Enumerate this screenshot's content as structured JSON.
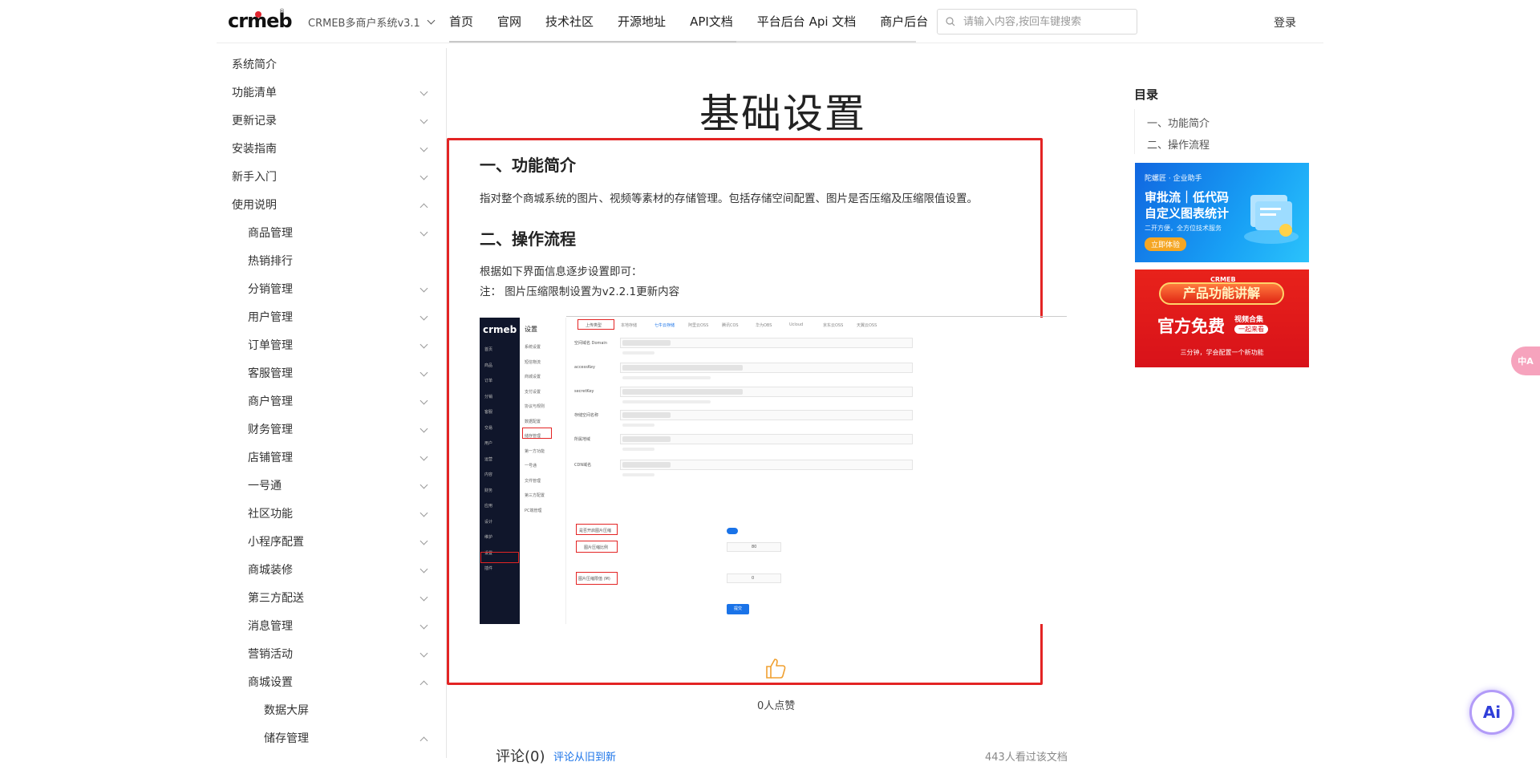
{
  "header": {
    "logo_text": "crmeb",
    "logo_reg": "®",
    "version": "CRMEB多商户系统v3.1",
    "nav": [
      "首页",
      "官网",
      "技术社区",
      "开源地址",
      "API文档",
      "平台后台 Api 文档",
      "商户后台"
    ],
    "search_placeholder": "请输入内容,按回车键搜索",
    "login": "登录"
  },
  "sidebar": {
    "items": [
      {
        "label": "系统简介",
        "level": 1,
        "chevron": "none"
      },
      {
        "label": "功能清单",
        "level": 1,
        "chevron": "down"
      },
      {
        "label": "更新记录",
        "level": 1,
        "chevron": "down"
      },
      {
        "label": "安装指南",
        "level": 1,
        "chevron": "down"
      },
      {
        "label": "新手入门",
        "level": 1,
        "chevron": "down"
      },
      {
        "label": "使用说明",
        "level": 1,
        "chevron": "up"
      },
      {
        "label": "商品管理",
        "level": 2,
        "chevron": "down"
      },
      {
        "label": "热销排行",
        "level": 2,
        "chevron": "none"
      },
      {
        "label": "分销管理",
        "level": 2,
        "chevron": "down"
      },
      {
        "label": "用户管理",
        "level": 2,
        "chevron": "down"
      },
      {
        "label": "订单管理",
        "level": 2,
        "chevron": "down"
      },
      {
        "label": "客服管理",
        "level": 2,
        "chevron": "down"
      },
      {
        "label": "商户管理",
        "level": 2,
        "chevron": "down"
      },
      {
        "label": "财务管理",
        "level": 2,
        "chevron": "down"
      },
      {
        "label": "店铺管理",
        "level": 2,
        "chevron": "down"
      },
      {
        "label": "一号通",
        "level": 2,
        "chevron": "down"
      },
      {
        "label": "社区功能",
        "level": 2,
        "chevron": "down"
      },
      {
        "label": "小程序配置",
        "level": 2,
        "chevron": "down"
      },
      {
        "label": "商城装修",
        "level": 2,
        "chevron": "down"
      },
      {
        "label": "第三方配送",
        "level": 2,
        "chevron": "down"
      },
      {
        "label": "消息管理",
        "level": 2,
        "chevron": "down"
      },
      {
        "label": "营销活动",
        "level": 2,
        "chevron": "down"
      },
      {
        "label": "商城设置",
        "level": 2,
        "chevron": "up"
      },
      {
        "label": "数据大屏",
        "level": 3,
        "chevron": "none"
      },
      {
        "label": "储存管理",
        "level": 3,
        "chevron": "up"
      }
    ]
  },
  "main": {
    "title": "基础设置",
    "section1_heading": "一、功能简介",
    "section1_text": "指对整个商城系统的图片、视频等素材的存储管理。包括存储空间配置、图片是否压缩及压缩限值设置。",
    "section2_heading": "二、操作流程",
    "section2_text1": "根据如下界面信息逐步设置即可：",
    "section2_text2": "注：   图片压缩限制设置为v2.2.1更新内容",
    "like_count": "0人点赞",
    "comments_title": "评论(0)",
    "comments_sort": "评论从旧到新",
    "views": "443人看过该文档"
  },
  "embedded_screenshot": {
    "logo": "crmeb",
    "sub_title": "设置",
    "side_items": [
      "首页",
      "商品",
      "订单",
      "分销",
      "客服",
      "交易",
      "用户",
      "运营",
      "内容",
      "财务",
      "应用",
      "设计",
      "维护",
      "设置",
      "插件"
    ],
    "sub_items": [
      "系统设置",
      "短信物流",
      "商城设置",
      "支付设置",
      "协议与规则",
      "数据配置",
      "储存管理",
      "第一方功能",
      "一号通",
      "文件管理",
      "第三方配置",
      "PC端管理"
    ],
    "upload_label": "上传类型",
    "upload_options": [
      "本地存储",
      "七牛云存储",
      "阿里云OSS",
      "腾讯COS",
      "华为OBS",
      "Ucloud",
      "京东云OSS",
      "天翼云OSS"
    ],
    "fields": [
      "空间域名 Domain",
      "accessKey",
      "secretKey",
      "存储空间名称",
      "所属地域",
      "CDN域名"
    ],
    "compress_label": "是否开启图片压缩",
    "ratio_label": "图片压缩比例",
    "ratio_value": "80",
    "limit_label": "图片压缩限值 (M)",
    "limit_value": "0",
    "submit": "提交"
  },
  "toc": {
    "title": "目录",
    "items": [
      "一、功能简介",
      "二、操作流程"
    ]
  },
  "ads": {
    "ad1": {
      "brand": "陀螺匠 · 企业助手",
      "line1": "审批流｜低代码",
      "line2": "自定义图表统计",
      "line3": "二开方便，全方位技术服务",
      "cta": "立即体验"
    },
    "ad2": {
      "brand": "CRMEB",
      "line1": "产品功能讲解",
      "line2": "官方免费",
      "tag1": "视频合集",
      "tag2": "一起来看",
      "bottom": "三分钟，学会配置一个新功能"
    }
  },
  "fab": {
    "translate": "中A",
    "ai": "Ai"
  }
}
